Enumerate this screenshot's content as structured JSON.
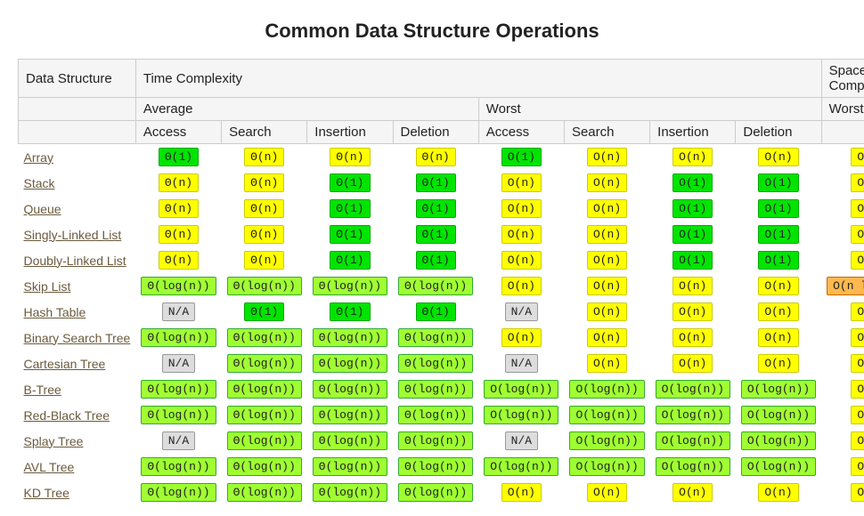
{
  "title": "Common Data Structure Operations",
  "headers": {
    "ds": "Data Structure",
    "time": "Time Complexity",
    "space": "Space Complexity",
    "avg": "Average",
    "worst": "Worst",
    "access": "Access",
    "search": "Search",
    "insertion": "Insertion",
    "deletion": "Deletion"
  },
  "colors": {
    "green": "#00e400",
    "lime": "#9fff32",
    "yellow": "#ffff00",
    "orange": "#ffb84d",
    "gray": "#dddddd"
  },
  "rows": [
    {
      "name": "Array",
      "avg": [
        [
          "Θ(1)",
          "green"
        ],
        [
          "Θ(n)",
          "yellow"
        ],
        [
          "Θ(n)",
          "yellow"
        ],
        [
          "Θ(n)",
          "yellow"
        ]
      ],
      "worst": [
        [
          "O(1)",
          "green"
        ],
        [
          "O(n)",
          "yellow"
        ],
        [
          "O(n)",
          "yellow"
        ],
        [
          "O(n)",
          "yellow"
        ]
      ],
      "space": [
        "O(n)",
        "yellow"
      ]
    },
    {
      "name": "Stack",
      "avg": [
        [
          "Θ(n)",
          "yellow"
        ],
        [
          "Θ(n)",
          "yellow"
        ],
        [
          "Θ(1)",
          "green"
        ],
        [
          "Θ(1)",
          "green"
        ]
      ],
      "worst": [
        [
          "O(n)",
          "yellow"
        ],
        [
          "O(n)",
          "yellow"
        ],
        [
          "O(1)",
          "green"
        ],
        [
          "O(1)",
          "green"
        ]
      ],
      "space": [
        "O(n)",
        "yellow"
      ]
    },
    {
      "name": "Queue",
      "avg": [
        [
          "Θ(n)",
          "yellow"
        ],
        [
          "Θ(n)",
          "yellow"
        ],
        [
          "Θ(1)",
          "green"
        ],
        [
          "Θ(1)",
          "green"
        ]
      ],
      "worst": [
        [
          "O(n)",
          "yellow"
        ],
        [
          "O(n)",
          "yellow"
        ],
        [
          "O(1)",
          "green"
        ],
        [
          "O(1)",
          "green"
        ]
      ],
      "space": [
        "O(n)",
        "yellow"
      ]
    },
    {
      "name": "Singly-Linked List",
      "avg": [
        [
          "Θ(n)",
          "yellow"
        ],
        [
          "Θ(n)",
          "yellow"
        ],
        [
          "Θ(1)",
          "green"
        ],
        [
          "Θ(1)",
          "green"
        ]
      ],
      "worst": [
        [
          "O(n)",
          "yellow"
        ],
        [
          "O(n)",
          "yellow"
        ],
        [
          "O(1)",
          "green"
        ],
        [
          "O(1)",
          "green"
        ]
      ],
      "space": [
        "O(n)",
        "yellow"
      ]
    },
    {
      "name": "Doubly-Linked List",
      "avg": [
        [
          "Θ(n)",
          "yellow"
        ],
        [
          "Θ(n)",
          "yellow"
        ],
        [
          "Θ(1)",
          "green"
        ],
        [
          "Θ(1)",
          "green"
        ]
      ],
      "worst": [
        [
          "O(n)",
          "yellow"
        ],
        [
          "O(n)",
          "yellow"
        ],
        [
          "O(1)",
          "green"
        ],
        [
          "O(1)",
          "green"
        ]
      ],
      "space": [
        "O(n)",
        "yellow"
      ]
    },
    {
      "name": "Skip List",
      "avg": [
        [
          "Θ(log(n))",
          "lime"
        ],
        [
          "Θ(log(n))",
          "lime"
        ],
        [
          "Θ(log(n))",
          "lime"
        ],
        [
          "Θ(log(n))",
          "lime"
        ]
      ],
      "worst": [
        [
          "O(n)",
          "yellow"
        ],
        [
          "O(n)",
          "yellow"
        ],
        [
          "O(n)",
          "yellow"
        ],
        [
          "O(n)",
          "yellow"
        ]
      ],
      "space": [
        "O(n log(n))",
        "orange"
      ]
    },
    {
      "name": "Hash Table",
      "avg": [
        [
          "N/A",
          "gray"
        ],
        [
          "Θ(1)",
          "green"
        ],
        [
          "Θ(1)",
          "green"
        ],
        [
          "Θ(1)",
          "green"
        ]
      ],
      "worst": [
        [
          "N/A",
          "gray"
        ],
        [
          "O(n)",
          "yellow"
        ],
        [
          "O(n)",
          "yellow"
        ],
        [
          "O(n)",
          "yellow"
        ]
      ],
      "space": [
        "O(n)",
        "yellow"
      ]
    },
    {
      "name": "Binary Search Tree",
      "avg": [
        [
          "Θ(log(n))",
          "lime"
        ],
        [
          "Θ(log(n))",
          "lime"
        ],
        [
          "Θ(log(n))",
          "lime"
        ],
        [
          "Θ(log(n))",
          "lime"
        ]
      ],
      "worst": [
        [
          "O(n)",
          "yellow"
        ],
        [
          "O(n)",
          "yellow"
        ],
        [
          "O(n)",
          "yellow"
        ],
        [
          "O(n)",
          "yellow"
        ]
      ],
      "space": [
        "O(n)",
        "yellow"
      ]
    },
    {
      "name": "Cartesian Tree",
      "avg": [
        [
          "N/A",
          "gray"
        ],
        [
          "Θ(log(n))",
          "lime"
        ],
        [
          "Θ(log(n))",
          "lime"
        ],
        [
          "Θ(log(n))",
          "lime"
        ]
      ],
      "worst": [
        [
          "N/A",
          "gray"
        ],
        [
          "O(n)",
          "yellow"
        ],
        [
          "O(n)",
          "yellow"
        ],
        [
          "O(n)",
          "yellow"
        ]
      ],
      "space": [
        "O(n)",
        "yellow"
      ]
    },
    {
      "name": "B-Tree",
      "avg": [
        [
          "Θ(log(n))",
          "lime"
        ],
        [
          "Θ(log(n))",
          "lime"
        ],
        [
          "Θ(log(n))",
          "lime"
        ],
        [
          "Θ(log(n))",
          "lime"
        ]
      ],
      "worst": [
        [
          "O(log(n))",
          "lime"
        ],
        [
          "O(log(n))",
          "lime"
        ],
        [
          "O(log(n))",
          "lime"
        ],
        [
          "O(log(n))",
          "lime"
        ]
      ],
      "space": [
        "O(n)",
        "yellow"
      ]
    },
    {
      "name": "Red-Black Tree",
      "avg": [
        [
          "Θ(log(n))",
          "lime"
        ],
        [
          "Θ(log(n))",
          "lime"
        ],
        [
          "Θ(log(n))",
          "lime"
        ],
        [
          "Θ(log(n))",
          "lime"
        ]
      ],
      "worst": [
        [
          "O(log(n))",
          "lime"
        ],
        [
          "O(log(n))",
          "lime"
        ],
        [
          "O(log(n))",
          "lime"
        ],
        [
          "O(log(n))",
          "lime"
        ]
      ],
      "space": [
        "O(n)",
        "yellow"
      ]
    },
    {
      "name": "Splay Tree",
      "avg": [
        [
          "N/A",
          "gray"
        ],
        [
          "Θ(log(n))",
          "lime"
        ],
        [
          "Θ(log(n))",
          "lime"
        ],
        [
          "Θ(log(n))",
          "lime"
        ]
      ],
      "worst": [
        [
          "N/A",
          "gray"
        ],
        [
          "O(log(n))",
          "lime"
        ],
        [
          "O(log(n))",
          "lime"
        ],
        [
          "O(log(n))",
          "lime"
        ]
      ],
      "space": [
        "O(n)",
        "yellow"
      ]
    },
    {
      "name": "AVL Tree",
      "avg": [
        [
          "Θ(log(n))",
          "lime"
        ],
        [
          "Θ(log(n))",
          "lime"
        ],
        [
          "Θ(log(n))",
          "lime"
        ],
        [
          "Θ(log(n))",
          "lime"
        ]
      ],
      "worst": [
        [
          "O(log(n))",
          "lime"
        ],
        [
          "O(log(n))",
          "lime"
        ],
        [
          "O(log(n))",
          "lime"
        ],
        [
          "O(log(n))",
          "lime"
        ]
      ],
      "space": [
        "O(n)",
        "yellow"
      ]
    },
    {
      "name": "KD Tree",
      "avg": [
        [
          "Θ(log(n))",
          "lime"
        ],
        [
          "Θ(log(n))",
          "lime"
        ],
        [
          "Θ(log(n))",
          "lime"
        ],
        [
          "Θ(log(n))",
          "lime"
        ]
      ],
      "worst": [
        [
          "O(n)",
          "yellow"
        ],
        [
          "O(n)",
          "yellow"
        ],
        [
          "O(n)",
          "yellow"
        ],
        [
          "O(n)",
          "yellow"
        ]
      ],
      "space": [
        "O(n)",
        "yellow"
      ]
    }
  ]
}
